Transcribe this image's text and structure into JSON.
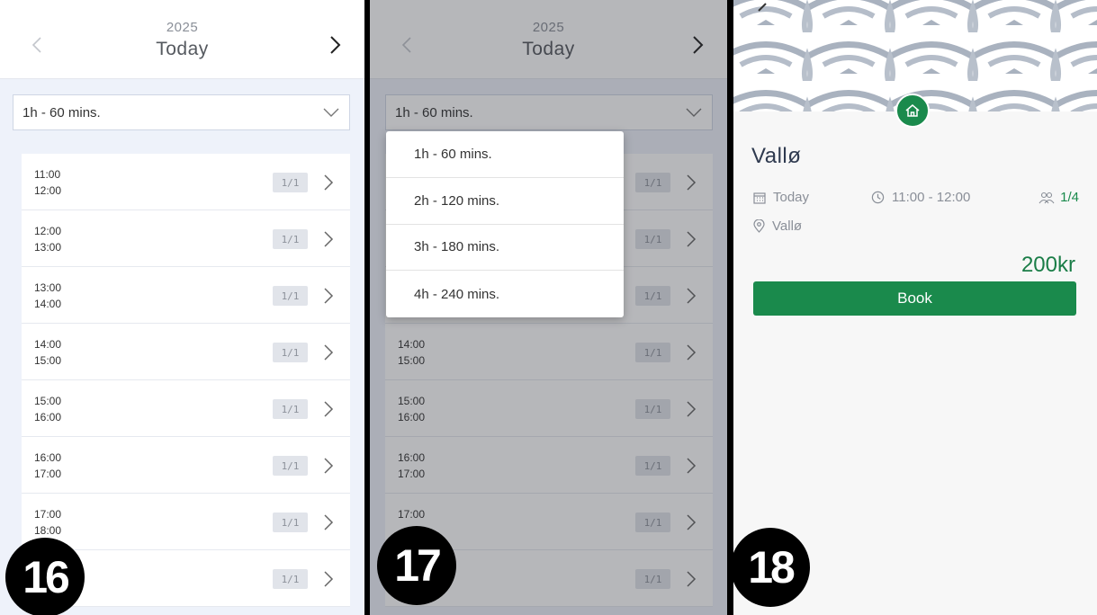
{
  "header": {
    "year": "2025",
    "today": "Today"
  },
  "duration_select": {
    "selected": "1h - 60 mins.",
    "options": [
      "1h - 60 mins.",
      "2h - 120 mins.",
      "3h - 180 mins.",
      "4h - 240 mins."
    ]
  },
  "slots": [
    {
      "start": "11:00",
      "end": "12:00",
      "capacity": "1/1"
    },
    {
      "start": "12:00",
      "end": "13:00",
      "capacity": "1/1"
    },
    {
      "start": "13:00",
      "end": "14:00",
      "capacity": "1/1"
    },
    {
      "start": "14:00",
      "end": "15:00",
      "capacity": "1/1"
    },
    {
      "start": "15:00",
      "end": "16:00",
      "capacity": "1/1"
    },
    {
      "start": "16:00",
      "end": "17:00",
      "capacity": "1/1"
    },
    {
      "start": "17:00",
      "end": "18:00",
      "capacity": "1/1"
    },
    {
      "start": "",
      "end": "",
      "capacity": "1/1"
    }
  ],
  "slots_panel17": [
    {
      "start": "",
      "end": "",
      "capacity": "1/1"
    },
    {
      "start": "",
      "end": "",
      "capacity": "1/1"
    },
    {
      "start": "",
      "end": "",
      "capacity": "1/1"
    },
    {
      "start": "14:00",
      "end": "15:00",
      "capacity": "1/1"
    },
    {
      "start": "15:00",
      "end": "16:00",
      "capacity": "1/1"
    },
    {
      "start": "16:00",
      "end": "17:00",
      "capacity": "1/1"
    },
    {
      "start": "17:00",
      "end": "",
      "capacity": "1/1"
    },
    {
      "start": "",
      "end": "",
      "capacity": "1/1"
    }
  ],
  "step_numbers": {
    "a": "16",
    "b": "17",
    "c": "18"
  },
  "detail": {
    "title": "Vallø",
    "date": "Today",
    "time": "11:00 - 12:00",
    "participants": "1/4",
    "location": "Vallø",
    "price": "200kr",
    "book_label": "Book"
  },
  "colors": {
    "accent": "#1a8a4c",
    "muted": "#8a8f98",
    "background": "#eef2fa"
  },
  "icons": [
    "chevron-left-icon",
    "chevron-right-icon",
    "chevron-down-icon",
    "home-icon",
    "calendar-icon",
    "clock-icon",
    "people-icon",
    "location-pin-icon"
  ]
}
